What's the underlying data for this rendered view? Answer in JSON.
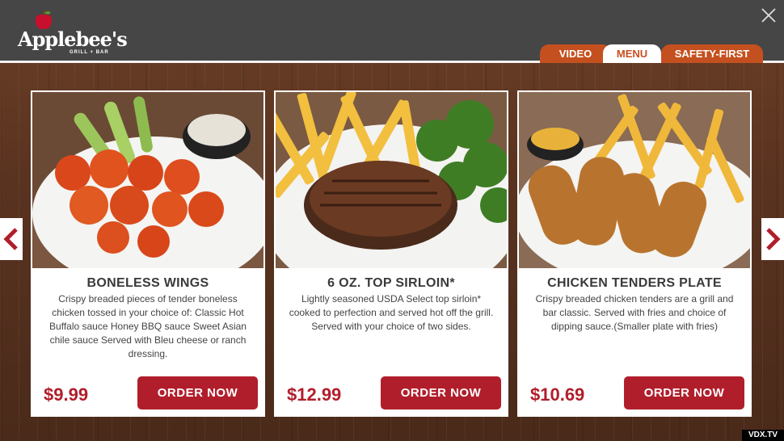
{
  "header": {
    "brand": "Applebee's",
    "brand_sub": "GRILL + BAR",
    "tabs": [
      {
        "label": "VIDEO",
        "active": false
      },
      {
        "label": "MENU",
        "active": true
      },
      {
        "label": "SAFETY-FIRST",
        "active": false
      }
    ]
  },
  "menu": {
    "items": [
      {
        "title": "BONELESS WINGS",
        "description": "Crispy breaded pieces of tender boneless chicken tossed in your choice of: Classic Hot Buffalo sauce Honey BBQ sauce Sweet Asian chile sauce Served with Bleu cheese or ranch dressing.",
        "price": "$9.99",
        "button": "ORDER NOW"
      },
      {
        "title": "6 OZ. TOP SIRLOIN*",
        "description": "Lightly seasoned USDA Select top sirloin* cooked to perfection and served hot off the grill. Served with your choice of two sides.",
        "price": "$12.99",
        "button": "ORDER NOW"
      },
      {
        "title": "CHICKEN TENDERS PLATE",
        "description": "Crispy breaded chicken tenders are a grill and bar classic. Served with fries and choice of dipping sauce.(Smaller plate with fries)",
        "price": "$10.69",
        "button": "ORDER NOW"
      }
    ]
  },
  "footer": {
    "watermark": "VDX.TV"
  },
  "colors": {
    "accent": "#b11e2b",
    "tab": "#c5501f",
    "header": "#464646"
  },
  "icons": {
    "close": "close-icon",
    "prev": "chevron-left-icon",
    "next": "chevron-right-icon"
  }
}
